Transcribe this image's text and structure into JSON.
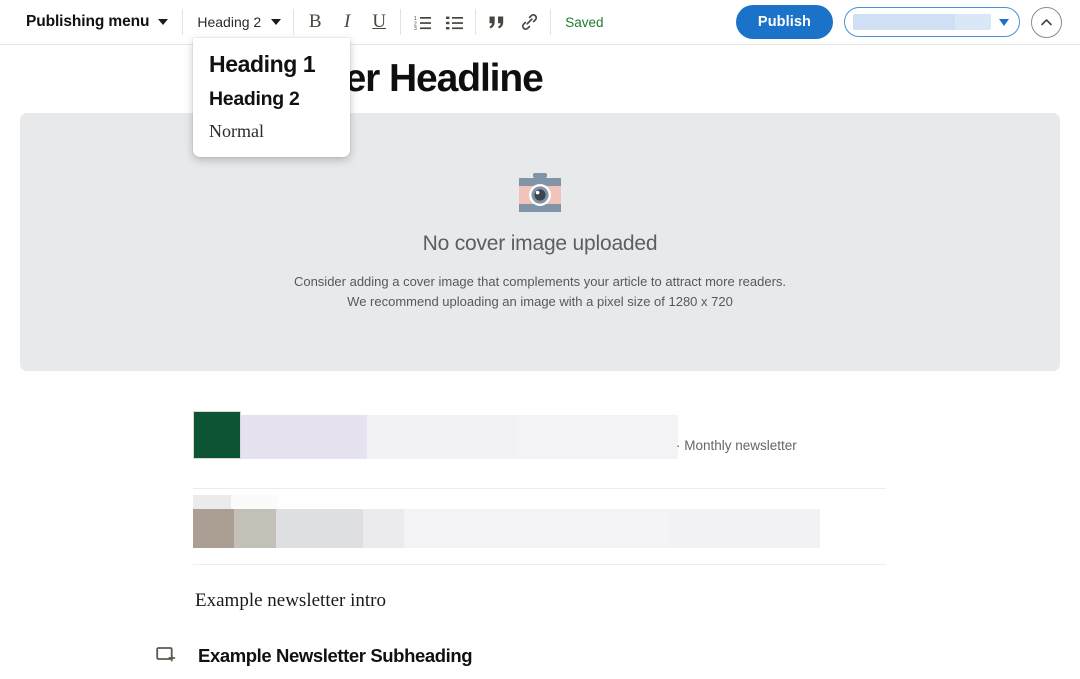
{
  "toolbar": {
    "publishing_menu_label": "Publishing menu",
    "publishing_menu_caret": "chevron-down-icon",
    "style_select_label": "Heading 2",
    "style_select_caret": "chevron-down-icon",
    "bold_label": "B",
    "italic_label": "I",
    "underline_label": "U",
    "ordered_list_icon": "ordered-list-icon",
    "bullet_list_icon": "bullet-list-icon",
    "quote_icon": "blockquote-icon",
    "link_icon": "link-icon",
    "saved_status": "Saved",
    "saved_color": "#1e7b34",
    "publish_label": "Publish",
    "publish_color": "#1a73c8",
    "audience_select_value": "",
    "audience_caret": "caret-down-icon",
    "collapse_icon": "chevron-up-icon"
  },
  "style_dropdown": {
    "options": [
      {
        "label": "Heading 1"
      },
      {
        "label": "Heading 2"
      },
      {
        "label": "Normal"
      }
    ]
  },
  "editor": {
    "headline": "Newsletter Headline",
    "cover": {
      "icon": "camera-icon",
      "title": "No cover image uploaded",
      "line1": "Consider adding a cover image that complements your article to attract more readers.",
      "line2": "We recommend uploading an image with a pixel size of 1280 x 720"
    },
    "media_row_1": {
      "thumbnail_alt": "green-foliage-thumbnail",
      "caption": "· Monthly newsletter"
    },
    "intro_text": "Example newsletter intro",
    "subheading": {
      "insert_icon": "insert-block-icon",
      "text": "Example Newsletter Subheading"
    }
  }
}
